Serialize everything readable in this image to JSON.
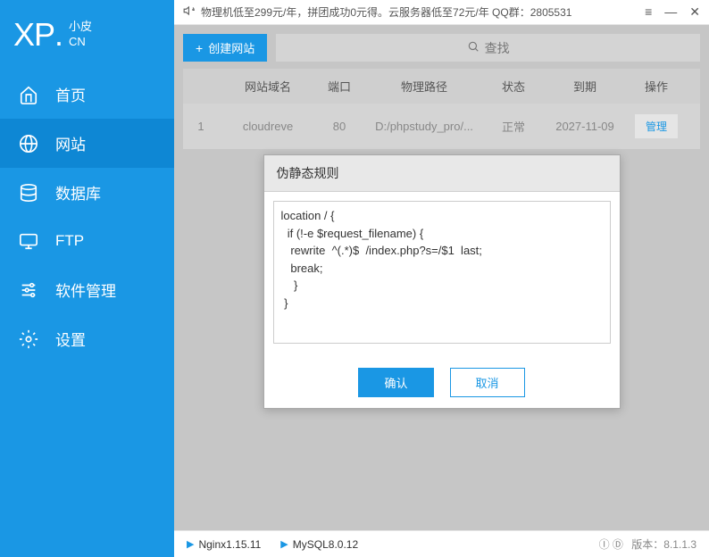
{
  "logo": {
    "main": "XP",
    "dot": ".",
    "top": "小皮",
    "bottom": "CN"
  },
  "nav": {
    "home": "首页",
    "website": "网站",
    "database": "数据库",
    "ftp": "FTP",
    "software": "软件管理",
    "settings": "设置"
  },
  "topbar": {
    "announcement": "物理机低至299元/年，拼团成功0元得。云服务器低至72元/年   QQ群：2805531"
  },
  "toolbar": {
    "create": "创建网站",
    "search": "查找"
  },
  "table": {
    "headers": {
      "domain": "网站域名",
      "port": "端口",
      "path": "物理路径",
      "status": "状态",
      "expire": "到期",
      "action": "操作"
    },
    "rows": [
      {
        "num": "1",
        "domain": "cloudreve",
        "port": "80",
        "path": "D:/phpstudy_pro/...",
        "status": "正常",
        "expire": "2027-11-09",
        "action": "管理"
      }
    ]
  },
  "dialog": {
    "title": "伪静态规则",
    "content": "location / {\n  if (!-e $request_filename) {\n   rewrite  ^(.*)$  /index.php?s=/$1  last;\n   break;\n    }\n }",
    "confirm": "确认",
    "cancel": "取消"
  },
  "statusbar": {
    "nginx": "Nginx1.15.11",
    "mysql": "MySQL8.0.12",
    "version_label": "版本：",
    "version": "8.1.1.3"
  }
}
